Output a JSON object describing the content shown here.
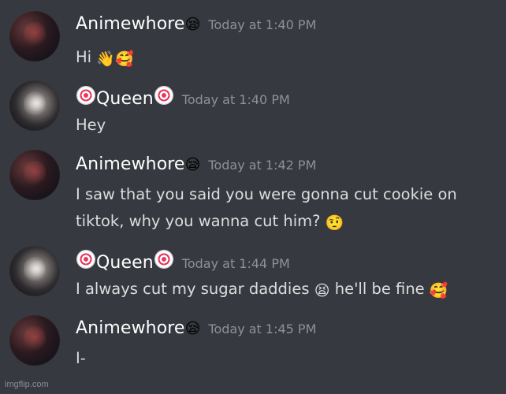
{
  "messages": [
    {
      "author": "Animewhore",
      "author_emoji": "😪",
      "timestamp": "Today at 1:40 PM",
      "lines": [
        "Hi"
      ],
      "line_emojis": [
        "👋🥰"
      ]
    },
    {
      "author": "Queen",
      "timestamp": "Today at 1:40 PM",
      "lines": [
        "Hey"
      ]
    },
    {
      "author": "Animewhore",
      "author_emoji": "😪",
      "timestamp": "Today at 1:42 PM",
      "lines": [
        "I saw that you said you were gonna cut cookie on",
        "tiktok, why you wanna cut him?"
      ],
      "end_emoji": "🤨"
    },
    {
      "author": "Queen",
      "timestamp": "Today at 1:44 PM",
      "text_before": "I always cut my sugar daddies",
      "mid_emoji": "😫",
      "text_after": "he'll be fine",
      "end_emoji": "🥰"
    },
    {
      "author": "Animewhore",
      "author_emoji": "😪",
      "timestamp": "Today at 1:45 PM",
      "lines": [
        "I-"
      ]
    }
  ],
  "watermark": "imgflip.com",
  "icons": {
    "queen_decoration": "narutomaki-icon"
  },
  "colors": {
    "background": "#36393f",
    "username": "#ffffff",
    "timestamp": "#8e9297",
    "message": "#dcddde"
  }
}
